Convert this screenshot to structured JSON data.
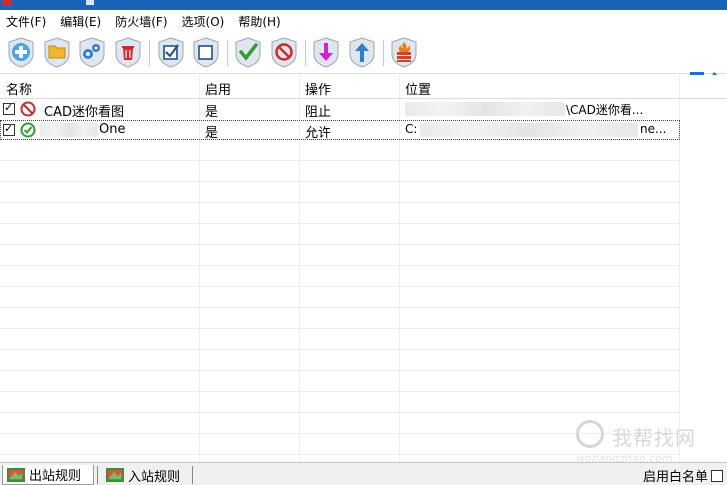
{
  "menu": [
    "文件(F)",
    "编辑(E)",
    "防火墙(F)",
    "选项(O)",
    "帮助(H)"
  ],
  "toolbar": {
    "buttons": [
      {
        "name": "add-icon"
      },
      {
        "name": "folder-icon"
      },
      {
        "name": "settings-icon"
      },
      {
        "name": "trash-icon"
      },
      {
        "name": "check-all-icon"
      },
      {
        "name": "uncheck-all-icon"
      },
      {
        "name": "allow-icon"
      },
      {
        "name": "block-icon"
      },
      {
        "name": "move-down-icon"
      },
      {
        "name": "move-up-icon"
      },
      {
        "name": "firewall-icon"
      }
    ],
    "colors": {
      "blue": "#2f7fd6",
      "green": "#2f9e2f",
      "red": "#d0282b",
      "magenta": "#d61fd6",
      "brand": "#1b6fd1"
    }
  },
  "table": {
    "headers": [
      "名称",
      "启用",
      "操作",
      "位置"
    ],
    "rows": [
      {
        "name": "CAD迷你看图",
        "enabled": "是",
        "action": "阻止",
        "location": "\\CAD迷你看...",
        "status_icon": "block-icon"
      },
      {
        "name": "One",
        "enabled": "是",
        "action": "允许",
        "location_prefix": "C:",
        "location_suffix": "ne...",
        "status_icon": "allow-icon"
      }
    ]
  },
  "status": {
    "tabs": [
      "出站规则",
      "入站规则"
    ],
    "whitelist_label": "启用白名单"
  },
  "watermark": {
    "text": "我帮找网",
    "url": "wobangzhao.com"
  }
}
